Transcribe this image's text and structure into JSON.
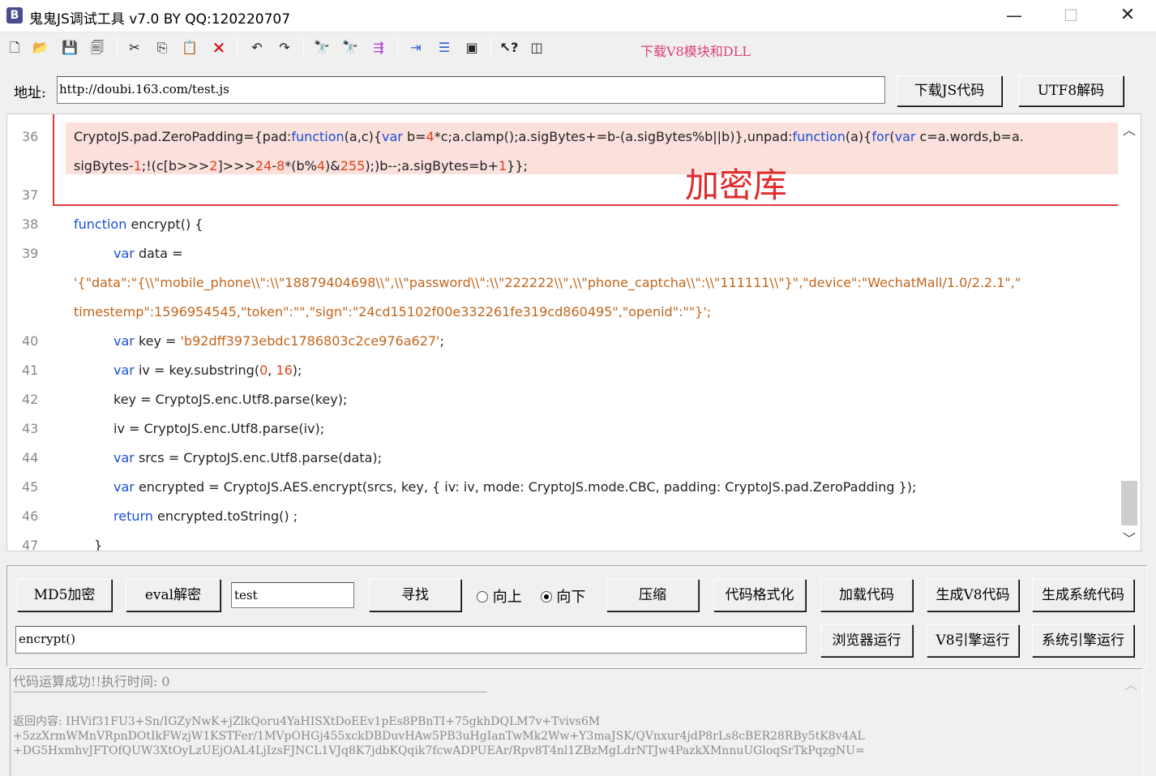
{
  "window": {
    "app_icon": "B",
    "title": "鬼鬼JS调试工具 v7.0 BY QQ:120220707",
    "minimize": "—",
    "maximize": "☐",
    "close": "✕"
  },
  "toolbar": {
    "icons": [
      "new-file-icon",
      "open-folder-icon",
      "save-icon",
      "save-all-icon",
      "cut-icon",
      "copy-icon",
      "paste-icon",
      "delete-icon",
      "undo-icon",
      "redo-icon",
      "find-icon",
      "find-next-icon",
      "replace-icon",
      "indent-icon",
      "numbered-list-icon",
      "window-icon",
      "help-icon",
      "panel-icon"
    ],
    "download_link": "下载V8模块和DLL"
  },
  "address": {
    "label": "地址:",
    "value": "http://doubi.163.com/test.js",
    "download_js_button": "下载JS代码",
    "utf8_decode_button": "UTF8解码"
  },
  "editor": {
    "highlight_label": "加密库",
    "lines": [
      {
        "no": "36",
        "text": "CryptoJS.pad.ZeroPadding={pad:function(a,c){var b=4*c;a.clamp();a.sigBytes+=b-(a.sigBytes%b||b)},unpad:function(a){for(var c=a.words,b=a."
      },
      {
        "no": "",
        "text": "sigBytes-1;!(c[b>>>2]>>>24-8*(b%4)&255);)b--;a.sigBytes=b+1}};"
      },
      {
        "no": "37",
        "text": ""
      },
      {
        "no": "38",
        "text": "function encrypt() {"
      },
      {
        "no": "39",
        "text": "var data ="
      },
      {
        "no": "",
        "text": "'{\"data\":\"{\\\\\"mobile_phone\\\\\":\\\\\"18879404698\\\\\",\\\\\"password\\\\\":\\\\\"222222\\\\\",\\\\\"phone_captcha\\\\\":\\\\\"111111\\\\\"}\",\"device\":\"WechatMall/1.0/2.2.1\",\""
      },
      {
        "no": "",
        "text": "timestemp\":1596954545,\"token\":\"\",\"sign\":\"24cd15102f00e332261fe319cd860495\",\"openid\":\"\"}';"
      },
      {
        "no": "40",
        "text": "var key = 'b92dff3973ebdc1786803c2ce976a627';"
      },
      {
        "no": "41",
        "text": "var iv = key.substring(0, 16);"
      },
      {
        "no": "42",
        "text": "key = CryptoJS.enc.Utf8.parse(key);"
      },
      {
        "no": "43",
        "text": "iv = CryptoJS.enc.Utf8.parse(iv);"
      },
      {
        "no": "44",
        "text": "var srcs = CryptoJS.enc.Utf8.parse(data);"
      },
      {
        "no": "45",
        "text": "var encrypted = CryptoJS.AES.encrypt(srcs, key, { iv: iv, mode: CryptoJS.mode.CBC, padding: CryptoJS.pad.ZeroPadding });"
      },
      {
        "no": "46",
        "text": "return encrypted.toString() ;"
      },
      {
        "no": "47",
        "text": "}"
      }
    ]
  },
  "controls": {
    "md5_button": "MD5加密",
    "eval_button": "eval解密",
    "search_value": "test",
    "find_button": "寻找",
    "radio_up": "向上",
    "radio_down": "向下",
    "compress_button": "压缩",
    "format_button": "代码格式化",
    "load_button": "加载代码",
    "gen_v8_button": "生成V8代码",
    "gen_sys_button": "生成系统代码",
    "function_value": "encrypt()",
    "browser_run_button": "浏览器运行",
    "v8_run_button": "V8引擎运行",
    "sys_run_button": "系统引擎运行"
  },
  "output": {
    "status": "代码运算成功!!执行时间: 0",
    "result": "返回内容: IHVif31FU3+Sn/IGZyNwK+jZlkQoru4YaHISXtDoEEv1pEs8PBnTI+75gkhDQLM7v+Tvivs6M\n+5zzXrmWMnVRpnDOtIkFWzjW1KSTFer/1MVpOHGj455xckDBDuvHAw5PB3uHgIanTwMk2Ww+Y3maJSK/QVnxur4jdP8rLs8cBER28RBy5tK8v4AL\n+DG5HxmhvJFTOfQUW3XtOyLzUEjOAL4LjIzsFJNCL1VJq8K7jdbKQqik7fcwADPUEAr/Rpv8T4nl1ZBzMgLdrNTJw4PazkXMnnuUGloqSrTkPqzgNU="
  }
}
